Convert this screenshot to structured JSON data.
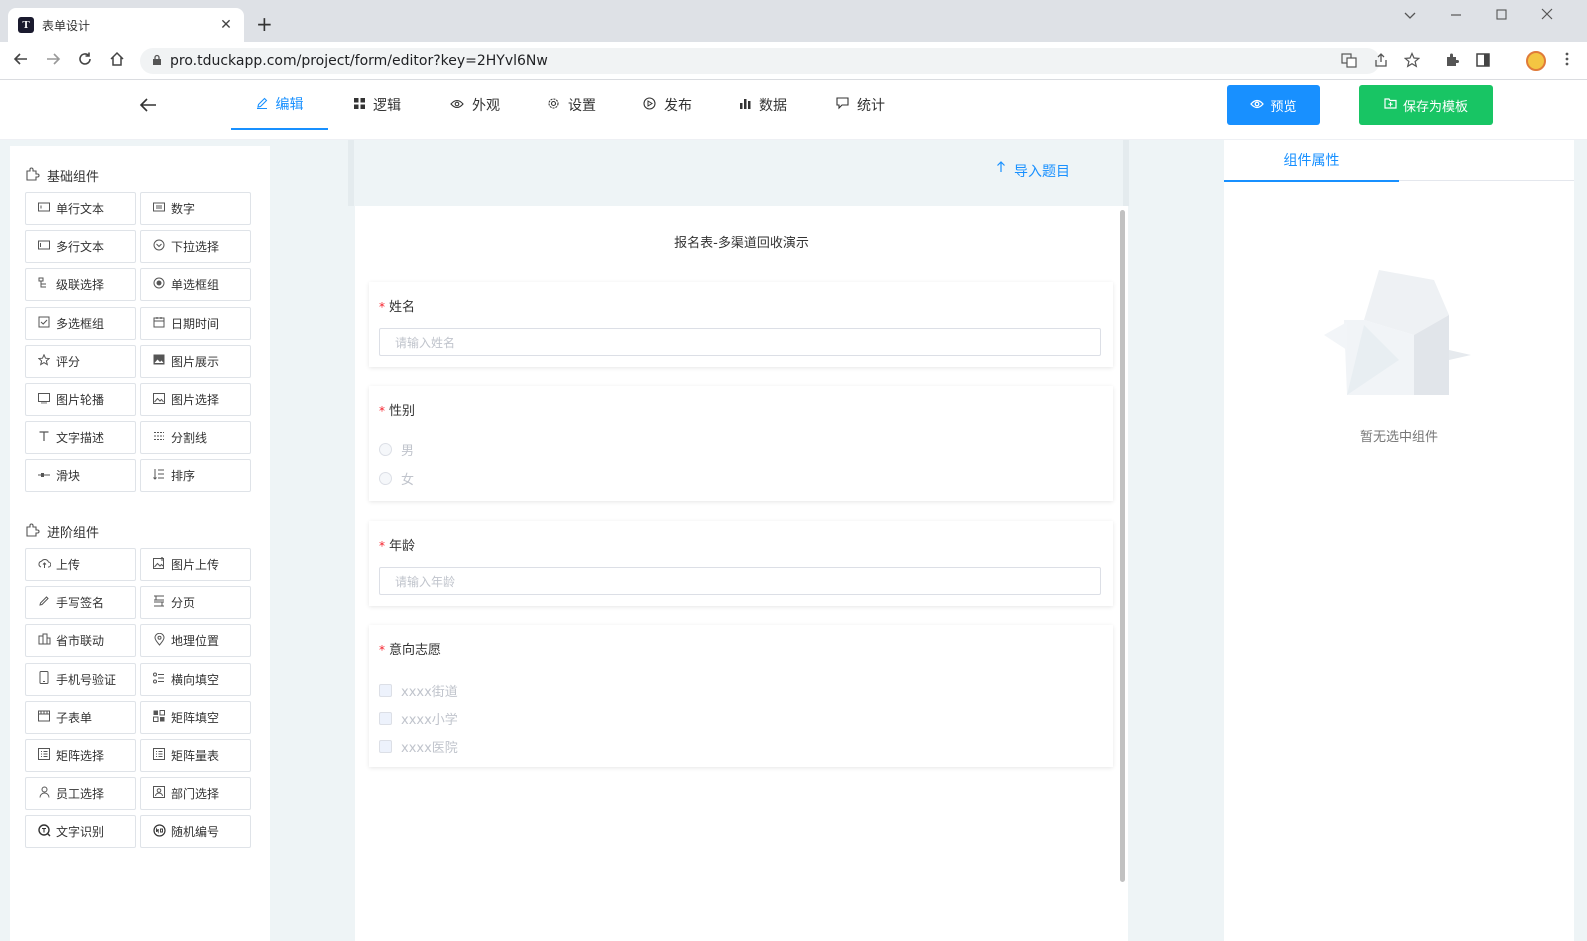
{
  "browser": {
    "tab_title": "表单设计",
    "tab_favicon": "T",
    "tab_close": "✕",
    "new_tab": "+",
    "url": "pro.tduckapp.com/project/form/editor?key=2HYvl6Nw"
  },
  "header": {
    "tabs": [
      {
        "label": "编辑",
        "icon": "edit-icon"
      },
      {
        "label": "逻辑",
        "icon": "grid-icon"
      },
      {
        "label": "外观",
        "icon": "eye-icon"
      },
      {
        "label": "设置",
        "icon": "gear-icon"
      },
      {
        "label": "发布",
        "icon": "play-icon"
      },
      {
        "label": "数据",
        "icon": "bar-chart-icon"
      },
      {
        "label": "统计",
        "icon": "chat-icon"
      }
    ],
    "active_tab": "编辑",
    "preview_label": "预览",
    "save_template_label": "保存为模板",
    "colors": {
      "primary": "#1890ff",
      "success": "#18c564"
    }
  },
  "left_panel": {
    "basic_title": "基础组件",
    "basic": [
      {
        "label": "单行文本",
        "icon": "input-icon"
      },
      {
        "label": "数字",
        "icon": "number-icon"
      },
      {
        "label": "多行文本",
        "icon": "textarea-icon"
      },
      {
        "label": "下拉选择",
        "icon": "select-icon"
      },
      {
        "label": "级联选择",
        "icon": "cascader-icon"
      },
      {
        "label": "单选框组",
        "icon": "radio-icon"
      },
      {
        "label": "多选框组",
        "icon": "checkbox-icon"
      },
      {
        "label": "日期时间",
        "icon": "calendar-icon"
      },
      {
        "label": "评分",
        "icon": "star-icon"
      },
      {
        "label": "图片展示",
        "icon": "image-icon"
      },
      {
        "label": "图片轮播",
        "icon": "carousel-icon"
      },
      {
        "label": "图片选择",
        "icon": "image-select-icon"
      },
      {
        "label": "文字描述",
        "icon": "text-icon"
      },
      {
        "label": "分割线",
        "icon": "divider-icon"
      },
      {
        "label": "滑块",
        "icon": "slider-icon"
      },
      {
        "label": "排序",
        "icon": "sort-icon"
      }
    ],
    "advanced_title": "进阶组件",
    "advanced": [
      {
        "label": "上传",
        "icon": "upload-icon"
      },
      {
        "label": "图片上传",
        "icon": "image-upload-icon"
      },
      {
        "label": "手写签名",
        "icon": "signature-icon"
      },
      {
        "label": "分页",
        "icon": "pagination-icon"
      },
      {
        "label": "省市联动",
        "icon": "city-icon"
      },
      {
        "label": "地理位置",
        "icon": "location-icon"
      },
      {
        "label": "手机号验证",
        "icon": "phone-icon"
      },
      {
        "label": "横向填空",
        "icon": "fill-blank-icon"
      },
      {
        "label": "子表单",
        "icon": "subform-icon"
      },
      {
        "label": "矩阵填空",
        "icon": "matrix-fill-icon"
      },
      {
        "label": "矩阵选择",
        "icon": "matrix-select-icon"
      },
      {
        "label": "矩阵量表",
        "icon": "matrix-scale-icon"
      },
      {
        "label": "员工选择",
        "icon": "user-icon"
      },
      {
        "label": "部门选择",
        "icon": "department-icon"
      },
      {
        "label": "文字识别",
        "icon": "ocr-icon"
      },
      {
        "label": "随机编号",
        "icon": "random-number-icon"
      }
    ]
  },
  "canvas": {
    "import_label": "导入题目",
    "form_title": "报名表-多渠道回收演示",
    "questions": [
      {
        "label": "姓名",
        "required_mark": "*",
        "type": "input",
        "placeholder": "请输入姓名"
      },
      {
        "label": "性别",
        "required_mark": "*",
        "type": "radio",
        "options": [
          "男",
          "女"
        ]
      },
      {
        "label": "年龄",
        "required_mark": "*",
        "type": "input",
        "placeholder": "请输入年龄"
      },
      {
        "label": "意向志愿",
        "required_mark": "*",
        "type": "checkbox",
        "options": [
          "xxxx街道",
          "xxxx小学",
          "xxxx医院"
        ]
      }
    ]
  },
  "right_panel": {
    "tab_label": "组件属性",
    "empty_text": "暂无选中组件"
  }
}
